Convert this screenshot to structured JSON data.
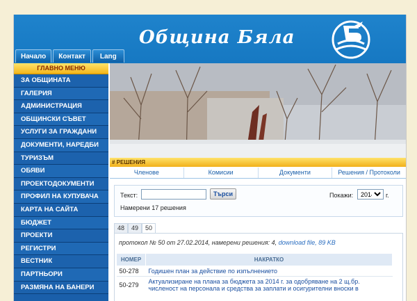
{
  "header": {
    "title": "Община Бяла",
    "tabs": [
      "Начало",
      "Контакт",
      "Lang"
    ]
  },
  "sidebar": {
    "heading": "ГЛАВНО МЕНЮ",
    "items": [
      "ЗА ОБЩИНАТА",
      "ГАЛЕРИЯ",
      "АДМИНИСТРАЦИЯ",
      "ОБЩИНСКИ СЪВЕТ",
      "УСЛУГИ ЗА ГРАЖДАНИ",
      "ДОКУМЕНТИ, НАРЕДБИ",
      "ТУРИЗЪМ",
      "ОБЯВИ",
      "ПРОЕКТОДОКУМЕНТИ",
      "ПРОФИЛ НА КУПУВАЧА",
      "КАРТА НА САЙТА",
      "БЮДЖЕТ",
      "ПРОЕКТИ",
      "РЕГИСТРИ",
      "ВЕСТНИК",
      "ПАРТНЬОРИ",
      "РАЗМЯНА НА БАНЕРИ"
    ]
  },
  "section": {
    "bar": "# РЕШЕНИЯ",
    "nav": [
      "Членове",
      "Комисии",
      "Документи",
      "Решения / Протоколи"
    ]
  },
  "search": {
    "label": "Текст:",
    "value": "",
    "button": "Търси",
    "found": "Намерени 17 решения",
    "year_label": "Покажи:",
    "year": "2014",
    "year_suffix": "г."
  },
  "protocol_tabs": [
    "48",
    "49",
    "50"
  ],
  "protocol": {
    "text": "протокол № 50 от 27.02.2014, намерени решения: 4,",
    "link": "download file, 89 KB"
  },
  "table": {
    "headers": [
      "НОМЕР",
      "НАКРАТКО"
    ],
    "rows": [
      {
        "num": "50-278",
        "text": "Годишен план за действие по изпълнението"
      },
      {
        "num": "50-279",
        "text": "Актуализиране на плана за бюджета за 2014 г. за одобряване на 2 щ.бр. численост на персонала и средства за заплати и осигурителни вноски в"
      }
    ]
  },
  "colors": {
    "header_blue": "#1678c2",
    "menu_blue": "#1c62ad",
    "accent_yellow": "#f3b51a",
    "background": "#f6efd6"
  }
}
